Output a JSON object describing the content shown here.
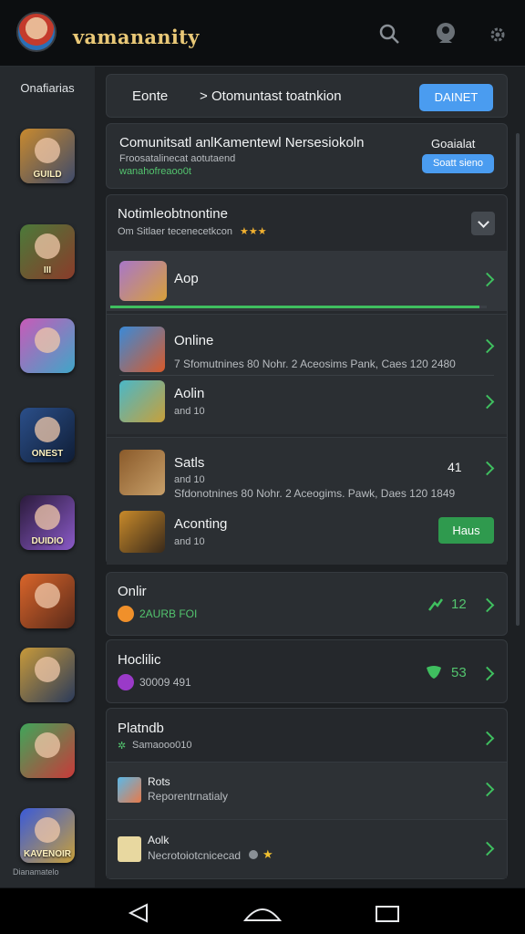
{
  "header": {
    "title": "vamananity",
    "icons": [
      "search-icon",
      "account-icon",
      "settings-icon"
    ]
  },
  "sidebar": {
    "title": "Onafiarias",
    "items": [
      {
        "label": "GUILD",
        "colors": [
          "#c98a2e",
          "#3d4a6a"
        ]
      },
      {
        "label": "III",
        "colors": [
          "#4b7a3a",
          "#8a3b2a"
        ]
      },
      {
        "label": "",
        "colors": [
          "#c85ab8",
          "#3fa6c8"
        ]
      },
      {
        "label": "ONEST",
        "colors": [
          "#2b4f8a",
          "#0f1d35"
        ]
      },
      {
        "label": "DUIDIO",
        "colors": [
          "#2a1a3a",
          "#8a5ac8"
        ]
      },
      {
        "label": "",
        "colors": [
          "#d9652a",
          "#5a2a1a"
        ]
      },
      {
        "label": "",
        "colors": [
          "#c89a3a",
          "#2a3a5a"
        ]
      },
      {
        "label": "",
        "colors": [
          "#3fa65a",
          "#c83a3a"
        ]
      },
      {
        "label": "KAVENOIR",
        "colors": [
          "#3a5ad8",
          "#c8a03a"
        ]
      }
    ],
    "footer": "Dianamatelo"
  },
  "breadcrumb": {
    "first": "Eonte",
    "separator": ">",
    "second": "Otomuntast  toatnkion",
    "button": "DAINET"
  },
  "summary": {
    "title": "Comunitsatl anlKamentewl  Nersesiokoln",
    "subtitle": "Froosatalinecat aotutaend",
    "subtitle2": "wanahofreaoo0t",
    "right_label": "Goaialat",
    "button": "Soatt sieno"
  },
  "notifications": {
    "title": "Notimleobtnontine",
    "subtitle": "Om Sitlaer tecenecetkcon",
    "stars": "★★★",
    "items": [
      {
        "title": "Aop",
        "progress": 0.98
      },
      {
        "title": "Online",
        "meta": "7 Sfomutnines  80  Nohr. 2 Aceosims  Pank,  Caes  120 2480"
      },
      {
        "title": "Aolin",
        "meta": "and 10"
      },
      {
        "title": "Satls",
        "meta": "and 10",
        "meta2": "Sfdonotnines  80  Nohr. 2 Aceogims. Pawk,  Daes  120 1849",
        "badge": "41"
      },
      {
        "title": "Aconting",
        "meta": "and 10",
        "button": "Haus"
      }
    ]
  },
  "sections": [
    {
      "title": "Onlir",
      "meta": "2AURB FOI",
      "count": "12"
    },
    {
      "title": "Hoclilic",
      "meta": "30009 491",
      "count": "53"
    },
    {
      "title": "Platndb",
      "meta": "Samaooo010"
    }
  ],
  "list": [
    {
      "title": "Rots",
      "meta": "Reporentrnatialy"
    },
    {
      "title": "Aolk",
      "meta": "Necrotoiotcnicecad",
      "extra": "★"
    }
  ],
  "colors": {
    "accent": "#4a9cf0",
    "success": "#3fbf5f",
    "gold": "#e9c877"
  }
}
